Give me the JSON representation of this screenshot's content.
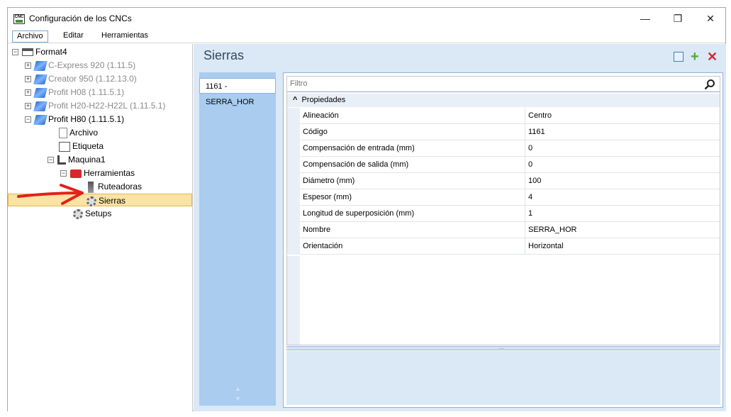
{
  "window": {
    "title": "Configuración de los CNCs",
    "app_icon_text": "CNC",
    "controls": {
      "minimize": "—",
      "maximize": "❐",
      "close": "✕"
    }
  },
  "menu": [
    "Archivo",
    "Editar",
    "Herramientas"
  ],
  "tree": {
    "root": "Format4",
    "machines": [
      {
        "label": "C-Express 920 (1.11.5)",
        "enabled": false
      },
      {
        "label": "Creator 950 (1.12.13.0)",
        "enabled": false
      },
      {
        "label": "Profit H08 (1.11.5.1)",
        "enabled": false
      },
      {
        "label": "Profit H20-H22-H22L (1.11.5.1)",
        "enabled": false
      },
      {
        "label": "Profit H80 (1.11.5.1)",
        "enabled": true
      }
    ],
    "archivo": "Archivo",
    "etiqueta": "Etiqueta",
    "maquina": "Maquina1",
    "herramientas": "Herramientas",
    "ruteadoras": "Ruteadoras",
    "sierras": "Sierras",
    "setups": "Setups",
    "expanders": {
      "collapsed": "+",
      "expanded": "−"
    }
  },
  "colors": {
    "arrow": "#e32119",
    "selection": "#fbe3a5",
    "panel_bg": "#dbe8f6"
  },
  "panel": {
    "title": "Sierras",
    "list_items": [
      "1161 - SERRA_HOR"
    ],
    "filter_placeholder": "Filtro",
    "group": {
      "label": "Propiedades",
      "caret": "^"
    },
    "properties": [
      {
        "name": "Alineación",
        "value": "Centro"
      },
      {
        "name": "Código",
        "value": "1161"
      },
      {
        "name": "Compensación de entrada (mm)",
        "value": "0"
      },
      {
        "name": "Compensación de salida (mm)",
        "value": "0"
      },
      {
        "name": "Diámetro (mm)",
        "value": "100"
      },
      {
        "name": "Espesor (mm)",
        "value": "4"
      },
      {
        "name": "Longitud de superposición (mm)",
        "value": "1"
      },
      {
        "name": "Nombre",
        "value": "SERRA_HOR"
      },
      {
        "name": "Orientación",
        "value": "Horizontal"
      }
    ],
    "splitter_grip": "·····",
    "scroll_up": "▲",
    "scroll_down": "▼"
  },
  "icons": [
    "copy-icon",
    "add-icon",
    "delete-icon",
    "search-icon",
    "gear-icon",
    "toolbox-icon",
    "vice-icon",
    "document-icon",
    "label-icon",
    "machine-icon",
    "factory-icon",
    "router-bit-icon"
  ]
}
